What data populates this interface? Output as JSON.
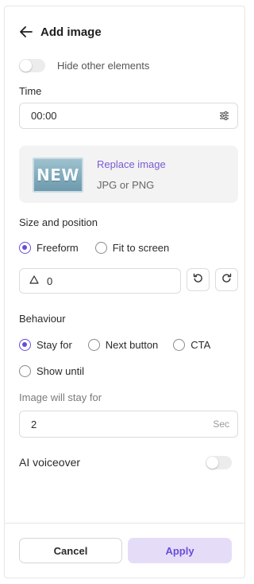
{
  "header": {
    "title": "Add image",
    "back_icon": "arrow-left-icon"
  },
  "hide_elements": {
    "label": "Hide other elements",
    "enabled": false
  },
  "time": {
    "label": "Time",
    "value": "00:00",
    "icon": "sliders-icon"
  },
  "image": {
    "thumbnail_text": "NEW",
    "replace_label": "Replace image",
    "format_hint": "JPG or PNG"
  },
  "size_position": {
    "label": "Size and position",
    "options": [
      {
        "label": "Freeform",
        "selected": true
      },
      {
        "label": "Fit to screen",
        "selected": false
      }
    ],
    "rotation_value": "0",
    "rotation_icon": "triangle-icon",
    "rotate_left_icon": "rotate-ccw-icon",
    "rotate_right_icon": "rotate-cw-icon"
  },
  "behaviour": {
    "label": "Behaviour",
    "options": [
      {
        "label": "Stay for",
        "selected": true
      },
      {
        "label": "Next button",
        "selected": false
      },
      {
        "label": "CTA",
        "selected": false
      },
      {
        "label": "Show until",
        "selected": false
      }
    ],
    "stay_label": "Image will stay for",
    "stay_value": "2",
    "stay_unit": "Sec"
  },
  "ai_voiceover": {
    "label": "AI voiceover",
    "enabled": false
  },
  "footer": {
    "cancel_label": "Cancel",
    "apply_label": "Apply"
  },
  "colors": {
    "accent": "#6a4cd8",
    "apply_bg": "#e5ddf8",
    "card_bg": "#f3f3f3"
  }
}
